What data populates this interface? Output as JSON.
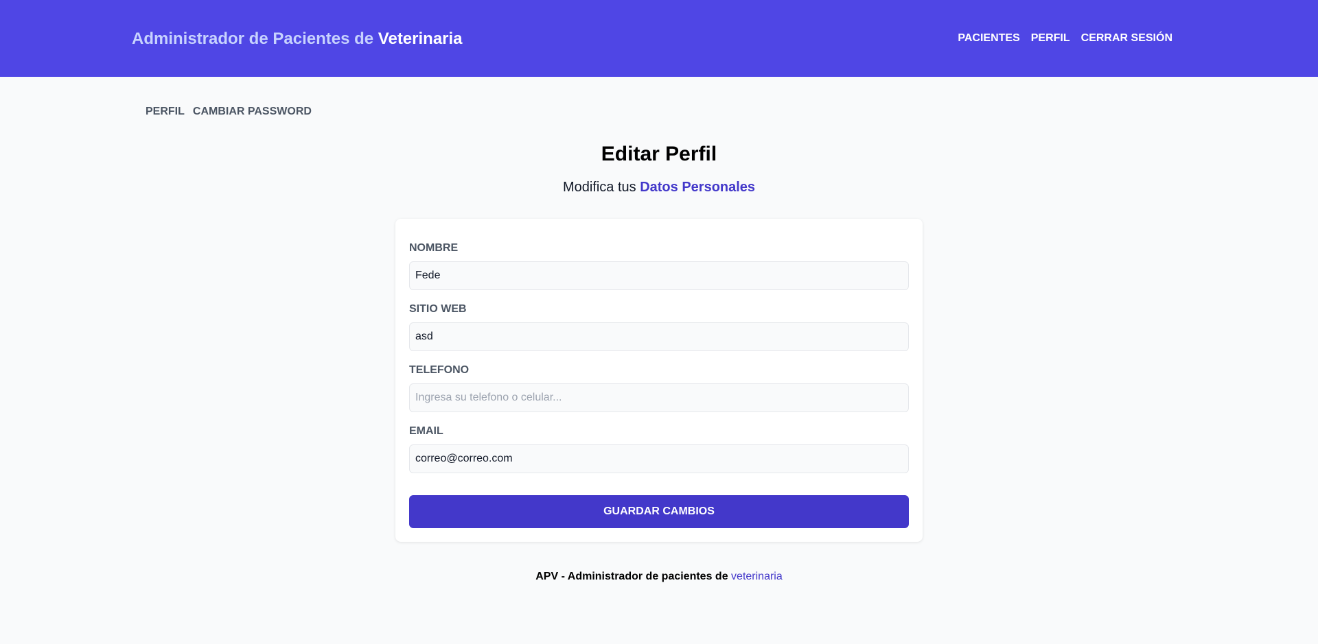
{
  "header": {
    "brand_prefix": "Administrador de Pacientes de ",
    "brand_strong": "Veterinaria",
    "nav": {
      "pacientes": "Pacientes",
      "perfil": "Perfil",
      "cerrar_sesion": "Cerrar Sesión"
    }
  },
  "subnav": {
    "perfil": "Perfil",
    "cambiar_password": "Cambiar Password"
  },
  "main": {
    "title": "Editar Perfil",
    "subtitle_prefix": "Modifica tus ",
    "subtitle_accent": "Datos Personales"
  },
  "form": {
    "nombre": {
      "label": "Nombre",
      "value": "Fede",
      "placeholder": ""
    },
    "web": {
      "label": "Sitio Web",
      "value": "asd",
      "placeholder": ""
    },
    "telefono": {
      "label": "Telefono",
      "value": "",
      "placeholder": "Ingresa su telefono o celular..."
    },
    "email": {
      "label": "Email",
      "value": "correo@correo.com",
      "placeholder": ""
    },
    "submit_label": "Guardar Cambios"
  },
  "footer": {
    "prefix": "APV - Administrador de pacientes de ",
    "accent": "veterinaria"
  },
  "colors": {
    "primary": "#4f46e5",
    "accent": "#4338ca",
    "background": "#f9fafb"
  }
}
